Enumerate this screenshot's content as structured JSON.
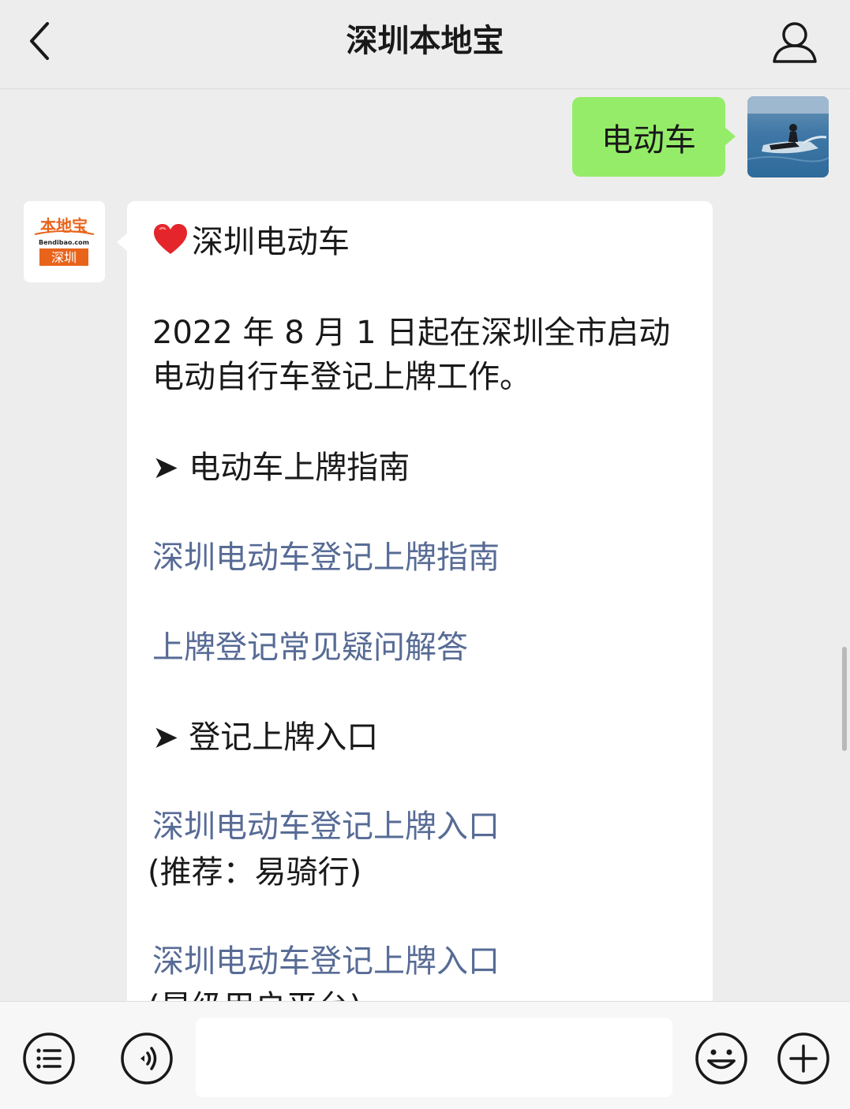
{
  "header": {
    "title": "深圳本地宝",
    "back_icon": "chevron-left-icon",
    "profile_icon": "person-icon"
  },
  "messages": {
    "user_text": "电动车",
    "bot_logo_text_top": "本地宝",
    "bot_logo_text_url": "Bendibao.com",
    "bot_logo_text_city": "深圳",
    "bot": {
      "heading": "深圳电动车",
      "intro_line1": "2022 年 8 月 1 日起在深圳全市启动",
      "intro_line2": "电动自行车登记上牌工作。",
      "section1": "➤ 电动车上牌指南",
      "link1": "深圳电动车登记上牌指南",
      "link2": "上牌登记常见疑问解答",
      "section2": "➤ 登记上牌入口",
      "link3": "深圳电动车登记上牌入口",
      "link3_note": "(推荐：易骑行)",
      "link4": "深圳电动车登记上牌入口",
      "link4_note": "(星级用户平台)"
    }
  },
  "input_bar": {
    "menu_icon": "list-icon",
    "voice_icon": "voice-icon",
    "emoji_icon": "emoji-icon",
    "plus_icon": "plus-icon"
  },
  "colors": {
    "background": "#ededed",
    "user_bubble": "#95ec69",
    "link": "#576b95",
    "logo_orange": "#e8641b"
  }
}
